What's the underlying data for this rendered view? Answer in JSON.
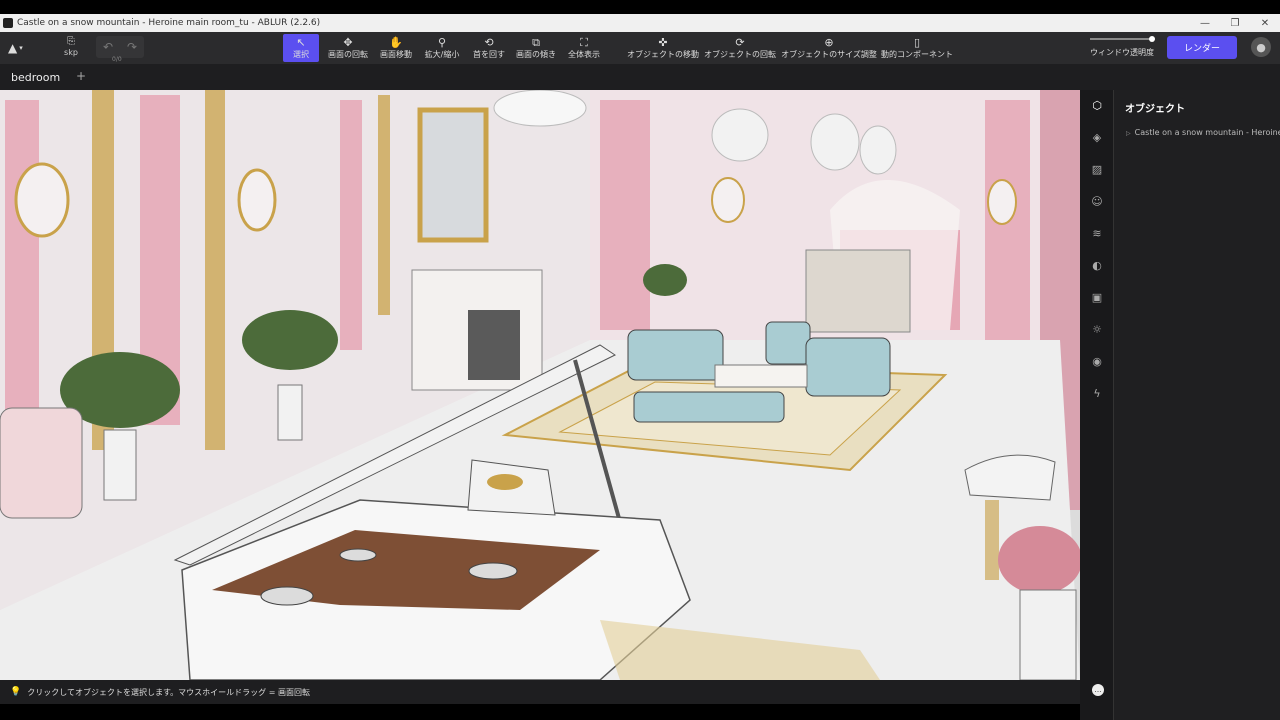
{
  "window": {
    "title": "Castle on a snow mountain - Heroine main room_tu - ABLUR (2.2.6)",
    "minimize": "—",
    "maximize": "❐",
    "close": "✕"
  },
  "toolbar": {
    "logo_icon": "▲",
    "file_label": "skp",
    "undo_icon": "↶",
    "redo_icon": "↷",
    "undo_count": "0/0",
    "tools": [
      {
        "name": "select",
        "label": "選択",
        "icon": "↖",
        "active": true
      },
      {
        "name": "orbit",
        "label": "画面の回転",
        "icon": "✥",
        "active": false
      },
      {
        "name": "pan",
        "label": "画面移動",
        "icon": "✋",
        "active": false
      },
      {
        "name": "zoom",
        "label": "拡大/縮小",
        "icon": "⚲",
        "active": false
      },
      {
        "name": "look-around",
        "label": "首を回す",
        "icon": "⟲",
        "active": false
      },
      {
        "name": "tilt",
        "label": "画面の傾き",
        "icon": "⧉",
        "active": false
      },
      {
        "name": "zoom-extents",
        "label": "全体表示",
        "icon": "⛶",
        "active": false
      },
      {
        "name": "move-object",
        "label": "オブジェクトの移動",
        "icon": "✜",
        "active": false
      },
      {
        "name": "rotate-object",
        "label": "オブジェクトの回転",
        "icon": "⟳",
        "active": false
      },
      {
        "name": "scale-object",
        "label": "オブジェクトのサイズ調整",
        "icon": "⊕",
        "active": false
      },
      {
        "name": "dynamic-component",
        "label": "動的コンポーネント",
        "icon": "▯",
        "active": false
      }
    ],
    "window_opacity_label": "ウィンドウ透明度",
    "window_opacity_value": 1.0,
    "render_label": "レンダー",
    "avatar_icon": "●"
  },
  "tabs": {
    "items": [
      "bedroom"
    ],
    "add_icon": "+"
  },
  "right_strip": {
    "icons": [
      {
        "name": "object-icon",
        "glyph": "⬡"
      },
      {
        "name": "layers-icon",
        "glyph": "◈"
      },
      {
        "name": "material-icon",
        "glyph": "▨"
      },
      {
        "name": "person-icon",
        "glyph": "☺"
      },
      {
        "name": "style-icon",
        "glyph": "≋"
      },
      {
        "name": "environment-icon",
        "glyph": "◐"
      },
      {
        "name": "image-icon",
        "glyph": "▣"
      },
      {
        "name": "light-icon",
        "glyph": "☼"
      },
      {
        "name": "camera-icon",
        "glyph": "◉"
      },
      {
        "name": "bolt-icon",
        "glyph": "ϟ"
      }
    ]
  },
  "object_panel": {
    "title": "オブジェクト",
    "tree_root": "Castle on a snow mountain - Heroine main room_tu",
    "expand_icon": "▷"
  },
  "status": {
    "bulb_icon": "💡",
    "hint": "クリックしてオブジェクトを選択します。マウスホイールドラッグ = 画面回転"
  },
  "chat_icon": "…",
  "colors": {
    "accent": "#5b4ff0",
    "wall_pink": "#e7b0bd",
    "gold": "#c9a24a",
    "floor": "#eeeeee",
    "teal_sofa": "#a9ccd2"
  }
}
